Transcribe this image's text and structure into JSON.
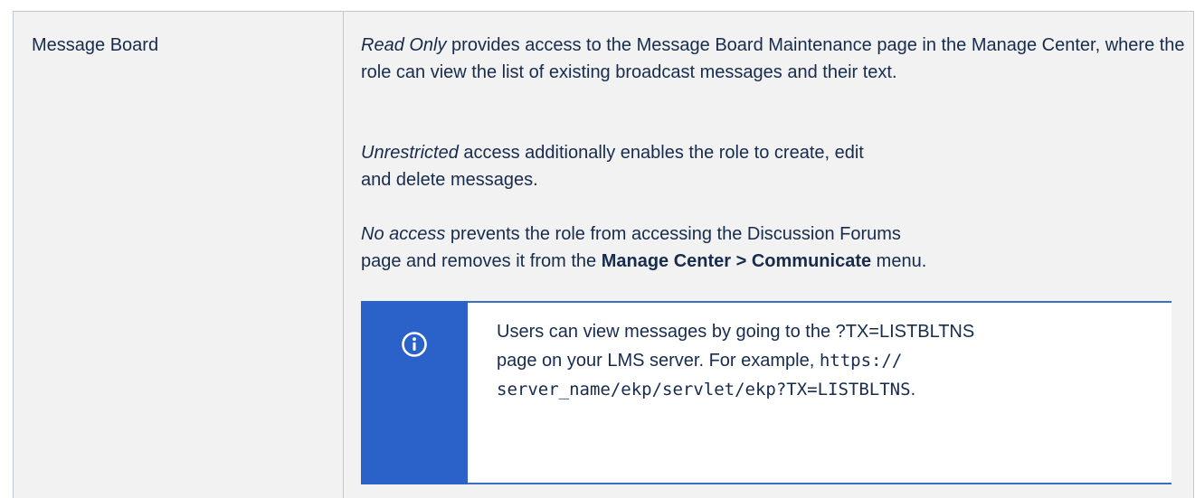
{
  "row": {
    "feature_name": "Message Board",
    "paragraphs": {
      "read_only": {
        "label": "Read Only",
        "text": " provides access to the Message Board Maintenance page in the Manage Center, where the role can view the list of existing broadcast messages and their text."
      },
      "unrestricted": {
        "label": "Unrestricted",
        "text_line1": " access additionally enables the role to create, edit",
        "text_line2": "and delete messages."
      },
      "no_access": {
        "label": "No access",
        "text_line1": " prevents the role from accessing the Discussion Forums",
        "text_line2_start": "page and removes it from the ",
        "menu_path": "Manage Center > Communicate",
        "text_line2_end": " menu."
      }
    },
    "info_panel": {
      "icon": "info-circle-icon",
      "text_line1": "Users can view messages by going to the ?TX=LISTBLTNS",
      "text_line2_start": "page on your LMS server. For example, ",
      "code_part1": "https://",
      "code_part2": "server_name/ekp/servlet/ekp?TX=LISTBLTNS",
      "text_end": "."
    }
  },
  "colors": {
    "cell_background": "#f2f2f2",
    "border": "#c1c7d0",
    "info_accent": "#2a62c9",
    "text": "#172b4d"
  }
}
